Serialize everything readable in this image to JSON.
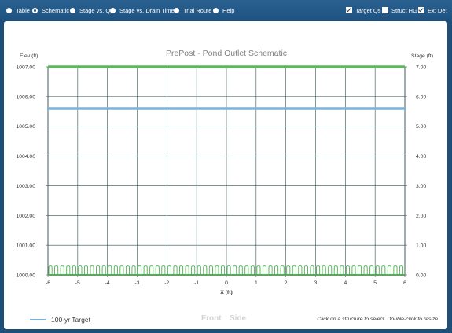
{
  "toolbar": {
    "radio_options": [
      {
        "label": "Table",
        "selected": false
      },
      {
        "label": "Schematic",
        "selected": true
      },
      {
        "label": "Stage vs. Q",
        "selected": false
      },
      {
        "label": "Stage vs. Drain Time",
        "selected": false
      },
      {
        "label": "Trial Route",
        "selected": false
      },
      {
        "label": "Help",
        "selected": false
      }
    ],
    "checkboxes": [
      {
        "label": "Target Qs",
        "checked": true
      },
      {
        "label": "Struct HG",
        "checked": false
      },
      {
        "label": "Ext Det",
        "checked": true
      }
    ]
  },
  "chart_data": {
    "type": "line",
    "title": "PrePost - Pond Outlet Schematic",
    "xlabel": "X (ft)",
    "ylabel_left": "Elev (ft)",
    "ylabel_right": "Stage (ft)",
    "x_ticks": [
      "-6",
      "-5",
      "-4",
      "-3",
      "-2",
      "-1",
      "0",
      "1",
      "2",
      "3",
      "4",
      "5",
      "6"
    ],
    "y_left_ticks": [
      "1007.00",
      "1006.00",
      "1005.00",
      "1004.00",
      "1003.00",
      "1002.00",
      "1001.00",
      "1000.00"
    ],
    "y_right_ticks": [
      "7.00",
      "6.00",
      "5.00",
      "4.00",
      "3.00",
      "2.00",
      "1.00",
      "0.00"
    ],
    "xlim": [
      -6,
      6
    ],
    "ylim": [
      1000,
      1007
    ],
    "grid": true,
    "series": [
      {
        "name": "100-yr Target",
        "elevation": 1005.6,
        "color": "#7fb2d8"
      },
      {
        "elevation": 1007.0,
        "color": "#5cb85c"
      }
    ],
    "bottom_pattern": {
      "color": "#4caf50",
      "top_elev": 1000.3,
      "loops": 60
    }
  },
  "footer": {
    "legend_label": "100-yr Target",
    "front_label": "Front",
    "side_label": "Side",
    "hint": "Click on a structure to select. Double-click to resize."
  },
  "colors": {
    "toolbar_bg": "#1e5381",
    "grid": "#2f4f4f",
    "green": "#5cb85c",
    "blue": "#7fb2d8"
  }
}
